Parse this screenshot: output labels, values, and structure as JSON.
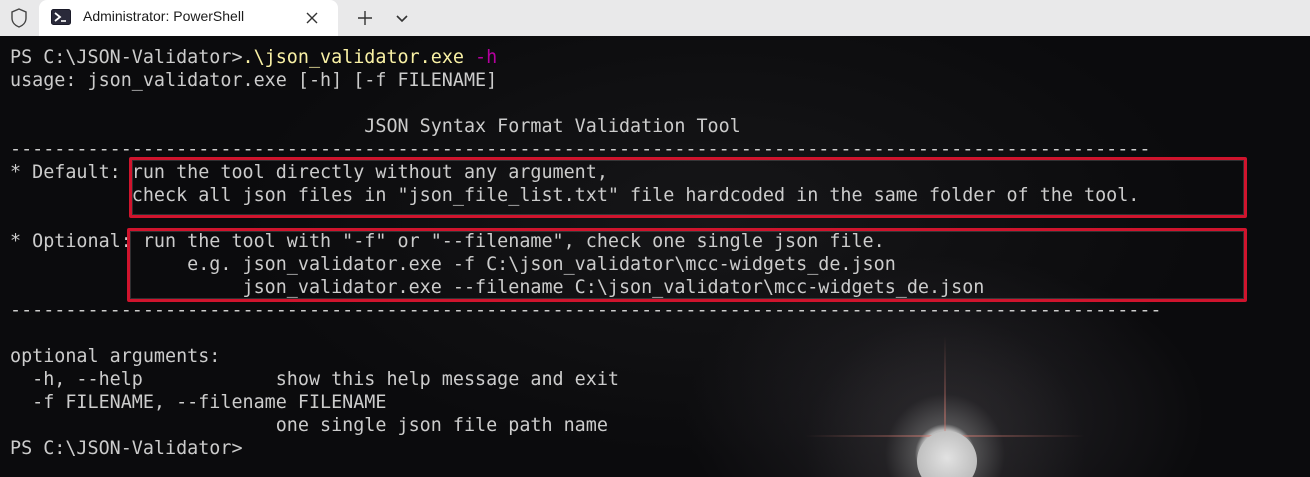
{
  "tabbar": {
    "tab_title": "Administrator: PowerShell",
    "icons": [
      "shield-icon",
      "powershell-icon",
      "close-icon",
      "plus-icon",
      "chevron-down-icon"
    ]
  },
  "console": {
    "prompt_path": "PS C:\\JSON-Validator>",
    "command": ".\\json_validator.exe",
    "command_arg": " -h",
    "usage": "usage: json_validator.exe [-h] [-f FILENAME]",
    "blank": "",
    "title": "                                JSON Syntax Format Validation Tool",
    "separator1": "-------------------------------------------------------------------------------------------------------",
    "default_line1": "* Default: run the tool directly without any argument,",
    "default_line2": "           check all json files in \"json_file_list.txt\" file hardcoded in the same folder of the tool.",
    "optional_line1": "* Optional: run the tool with \"-f\" or \"--filename\", check one single json file.",
    "optional_line2": "                e.g. json_validator.exe -f C:\\json_validator\\mcc-widgets_de.json",
    "optional_line3": "                     json_validator.exe --filename C:\\json_validator\\mcc-widgets_de.json",
    "separator2": "--------------------------------------------------------------------------------------------------------",
    "opt_header": "optional arguments:",
    "opt_help": "  -h, --help            show this help message and exit",
    "opt_file": "  -f FILENAME, --filename FILENAME",
    "opt_file_desc": "                        one single json file path name",
    "final_prompt": "PS C:\\JSON-Validator>"
  },
  "colors": {
    "text": "#cccccc",
    "command": "#f9f1a5",
    "parameter": "#b4009e",
    "highlight_box": "#d0142d"
  }
}
